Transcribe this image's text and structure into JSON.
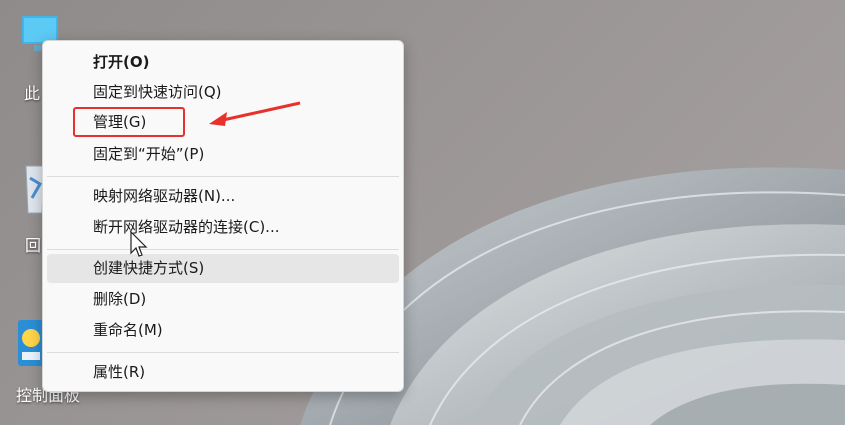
{
  "desktop": {
    "icon_labels": [
      "此",
      "回",
      "控制面板"
    ],
    "icons": [
      "this-pc-icon",
      "recycle-bin-icon",
      "control-panel-icon"
    ]
  },
  "context_menu": {
    "items": [
      {
        "label": "打开(O)"
      },
      {
        "label": "固定到快速访问(Q)"
      },
      {
        "label": "管理(G)"
      },
      {
        "label": "固定到“开始”(P)"
      },
      {
        "label": "映射网络驱动器(N)..."
      },
      {
        "label": "断开网络驱动器的连接(C)..."
      },
      {
        "label": "创建快捷方式(S)"
      },
      {
        "label": "删除(D)"
      },
      {
        "label": "重命名(M)"
      },
      {
        "label": "属性(R)"
      }
    ]
  },
  "annotation": {
    "highlight_color": "#e8302c",
    "highlighted_item": "管理(G)"
  },
  "colors": {
    "menu_bg": "#f9f9f9",
    "hover_bg": "#e6e6e6"
  }
}
